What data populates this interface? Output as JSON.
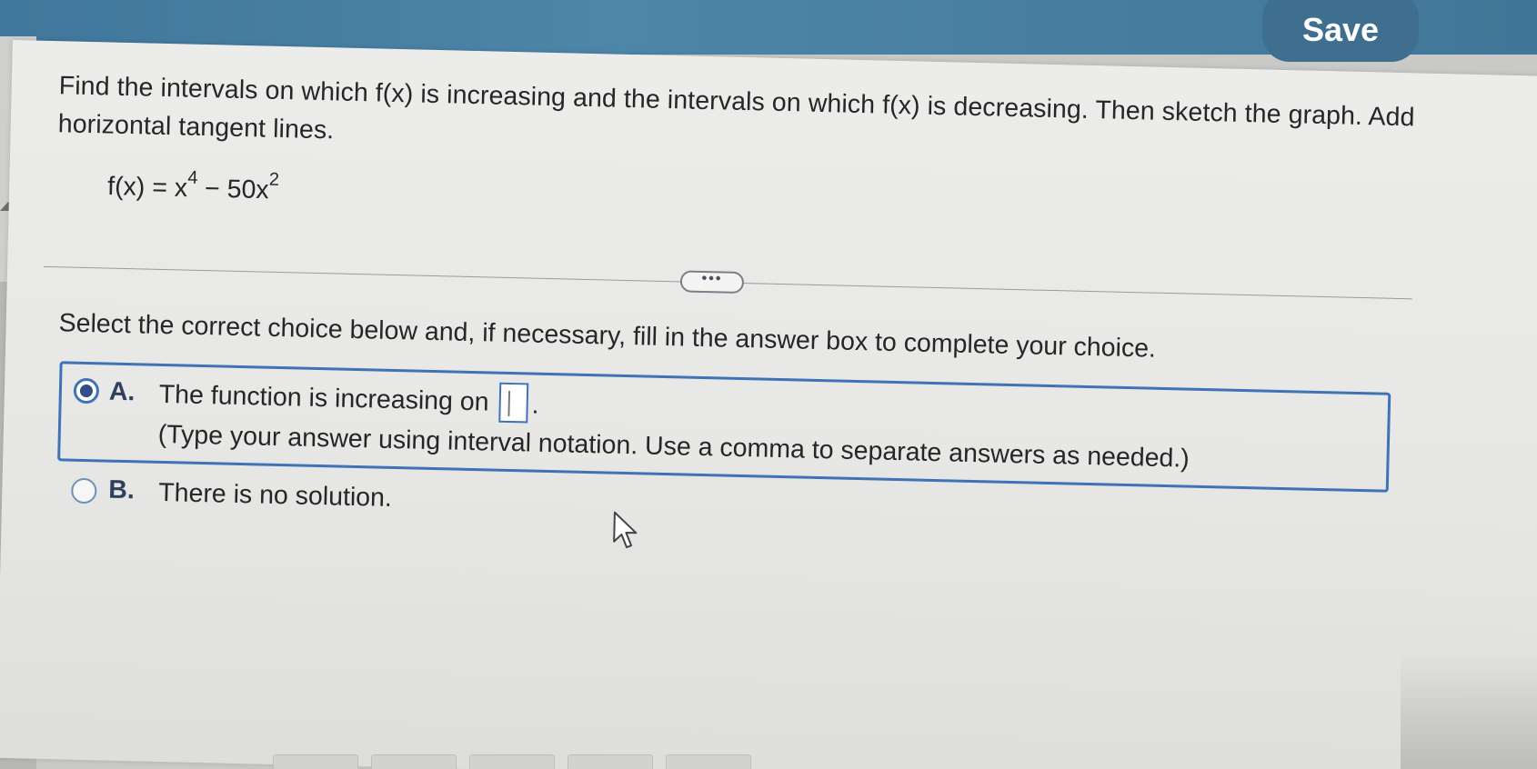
{
  "header": {
    "save_label": "Save"
  },
  "question": {
    "prompt": "Find the intervals on which f(x) is increasing and the intervals on which f(x) is decreasing.  Then sketch the graph. Add horizontal tangent lines.",
    "formula_lhs": "f(x) = x",
    "formula_exp1": "4",
    "formula_mid": " − 50x",
    "formula_exp2": "2"
  },
  "divider": {
    "more_label": "•••"
  },
  "instruction": "Select the correct choice below and, if necessary, fill in the answer box to complete your choice.",
  "choices": [
    {
      "letter": "A.",
      "line1": "The function is increasing on",
      "line1_suffix": ".",
      "line2": "(Type your answer using interval notation. Use a comma to separate answers as needed.)",
      "selected": true,
      "answer_value": ""
    },
    {
      "letter": "B.",
      "line1": "There is no solution.",
      "selected": false
    }
  ],
  "colors": {
    "topbar": "#4d86a9",
    "save_button": "#3f6f8f",
    "accent": "#3e73b8",
    "panel": "#ececea"
  },
  "icons": {
    "cursor": "cursor-arrow-icon",
    "collapse": "collapse-up-icon"
  }
}
